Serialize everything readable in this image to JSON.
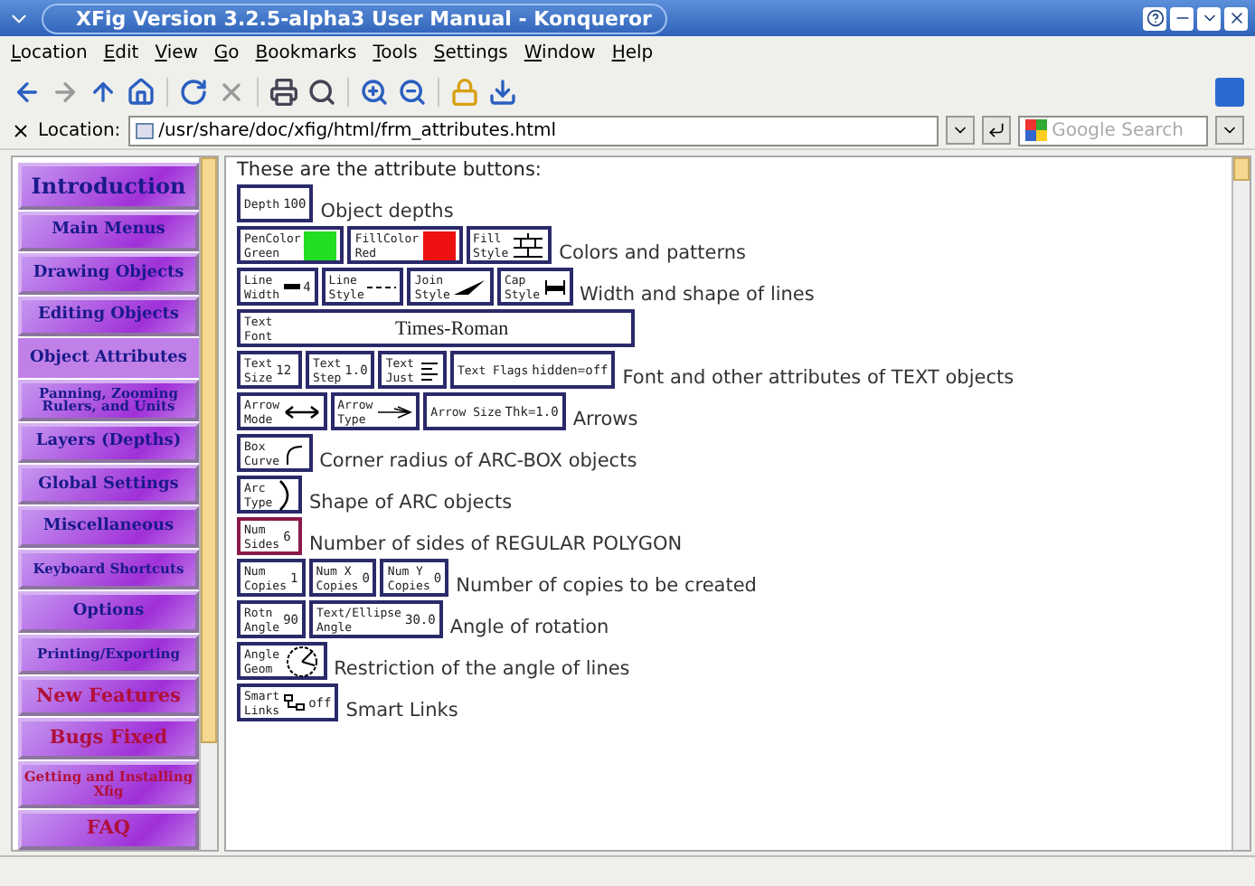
{
  "window": {
    "title": "XFig Version 3.2.5-alpha3 User Manual - Konqueror"
  },
  "menu": [
    "Location",
    "Edit",
    "View",
    "Go",
    "Bookmarks",
    "Tools",
    "Settings",
    "Window",
    "Help"
  ],
  "location": {
    "label": "Location:",
    "url": "/usr/share/doc/xfig/html/frm_attributes.html",
    "search_placeholder": "Google Search"
  },
  "nav": [
    {
      "label": "Introduction",
      "kind": "title",
      "selected": false
    },
    {
      "label": "Main Menus",
      "kind": "main",
      "selected": false
    },
    {
      "label": "Drawing Objects",
      "kind": "main",
      "selected": false
    },
    {
      "label": "Editing Objects",
      "kind": "main",
      "selected": false
    },
    {
      "label": "Object Attributes",
      "kind": "main",
      "selected": true
    },
    {
      "label": "Panning, Zooming Rulers, and Units",
      "kind": "small",
      "selected": false
    },
    {
      "label": "Layers (Depths)",
      "kind": "main",
      "selected": false
    },
    {
      "label": "Global Settings",
      "kind": "main",
      "selected": false
    },
    {
      "label": "Miscellaneous",
      "kind": "main",
      "selected": false
    },
    {
      "label": "Keyboard Shortcuts",
      "kind": "small",
      "selected": false
    },
    {
      "label": "Options",
      "kind": "main",
      "selected": false
    },
    {
      "label": "Printing/Exporting",
      "kind": "small",
      "selected": false
    },
    {
      "label": "New Features",
      "kind": "extra",
      "selected": false
    },
    {
      "label": "Bugs Fixed",
      "kind": "extra",
      "selected": false
    },
    {
      "label": "Getting and Installing Xfig",
      "kind": "extra-small",
      "selected": false
    },
    {
      "label": "FAQ",
      "kind": "extra",
      "selected": false
    }
  ],
  "intro": "These are the attribute buttons:",
  "rows": [
    {
      "description": "Object depths",
      "buttons": [
        {
          "kind": "value",
          "lines": [
            "Depth"
          ],
          "value": "100"
        }
      ]
    },
    {
      "description": "Colors and patterns",
      "buttons": [
        {
          "kind": "swatch",
          "lines": [
            "PenColor",
            "Green"
          ],
          "color": "#22dd22"
        },
        {
          "kind": "swatch",
          "lines": [
            "FillColor",
            "Red"
          ],
          "color": "#ee1111"
        },
        {
          "kind": "icon",
          "lines": [
            "Fill",
            "Style"
          ]
        }
      ]
    },
    {
      "description": "Width and shape of lines",
      "buttons": [
        {
          "kind": "icon",
          "lines": [
            "Line",
            "Width"
          ],
          "value": "4"
        },
        {
          "kind": "icon",
          "lines": [
            "Line",
            "Style"
          ]
        },
        {
          "kind": "icon",
          "lines": [
            "Join",
            "Style"
          ]
        },
        {
          "kind": "icon",
          "lines": [
            "Cap",
            "Style"
          ]
        }
      ]
    },
    {
      "buttons": [
        {
          "kind": "font",
          "lines": [
            "Text",
            "Font"
          ],
          "value": "Times-Roman"
        }
      ]
    },
    {
      "description": "Font and other attributes of TEXT objects",
      "buttons": [
        {
          "kind": "value",
          "lines": [
            "Text",
            "Size"
          ],
          "value": "12"
        },
        {
          "kind": "value",
          "lines": [
            "Text",
            "Step"
          ],
          "value": "1.0"
        },
        {
          "kind": "icon",
          "lines": [
            "Text",
            "Just"
          ]
        },
        {
          "kind": "value",
          "lines": [
            "Text Flags"
          ],
          "value": "hidden=off"
        }
      ]
    },
    {
      "description": "Arrows",
      "buttons": [
        {
          "kind": "icon",
          "lines": [
            "Arrow",
            "Mode"
          ]
        },
        {
          "kind": "icon",
          "lines": [
            "Arrow",
            "Type"
          ]
        },
        {
          "kind": "value",
          "lines": [
            "Arrow Size"
          ],
          "value": "Thk=1.0"
        }
      ]
    },
    {
      "description": "Corner radius of ARC-BOX objects",
      "buttons": [
        {
          "kind": "icon",
          "lines": [
            "Box",
            "Curve"
          ]
        }
      ]
    },
    {
      "description": "Shape of ARC objects",
      "buttons": [
        {
          "kind": "icon",
          "lines": [
            "Arc",
            "Type"
          ]
        }
      ]
    },
    {
      "description": "Number of sides of REGULAR POLYGON",
      "buttons": [
        {
          "kind": "value",
          "lines": [
            "Num",
            "Sides"
          ],
          "value": "6",
          "disabled": true
        }
      ]
    },
    {
      "description": "Number of copies to be created",
      "buttons": [
        {
          "kind": "value",
          "lines": [
            "Num",
            "Copies"
          ],
          "value": "1"
        },
        {
          "kind": "value",
          "lines": [
            "Num X",
            "Copies"
          ],
          "value": "0"
        },
        {
          "kind": "value",
          "lines": [
            "Num Y",
            "Copies"
          ],
          "value": "0"
        }
      ]
    },
    {
      "description": "Angle of rotation",
      "buttons": [
        {
          "kind": "value",
          "lines": [
            "Rotn",
            "Angle"
          ],
          "value": "90"
        },
        {
          "kind": "value",
          "lines": [
            "Text/Ellipse",
            "Angle"
          ],
          "value": "30.0"
        }
      ]
    },
    {
      "description": "Restriction of the angle of lines",
      "buttons": [
        {
          "kind": "icon",
          "lines": [
            "Angle",
            "Geom"
          ]
        }
      ]
    },
    {
      "description": "Smart Links",
      "buttons": [
        {
          "kind": "icon",
          "lines": [
            "Smart",
            "Links"
          ],
          "value": "off"
        }
      ]
    }
  ]
}
